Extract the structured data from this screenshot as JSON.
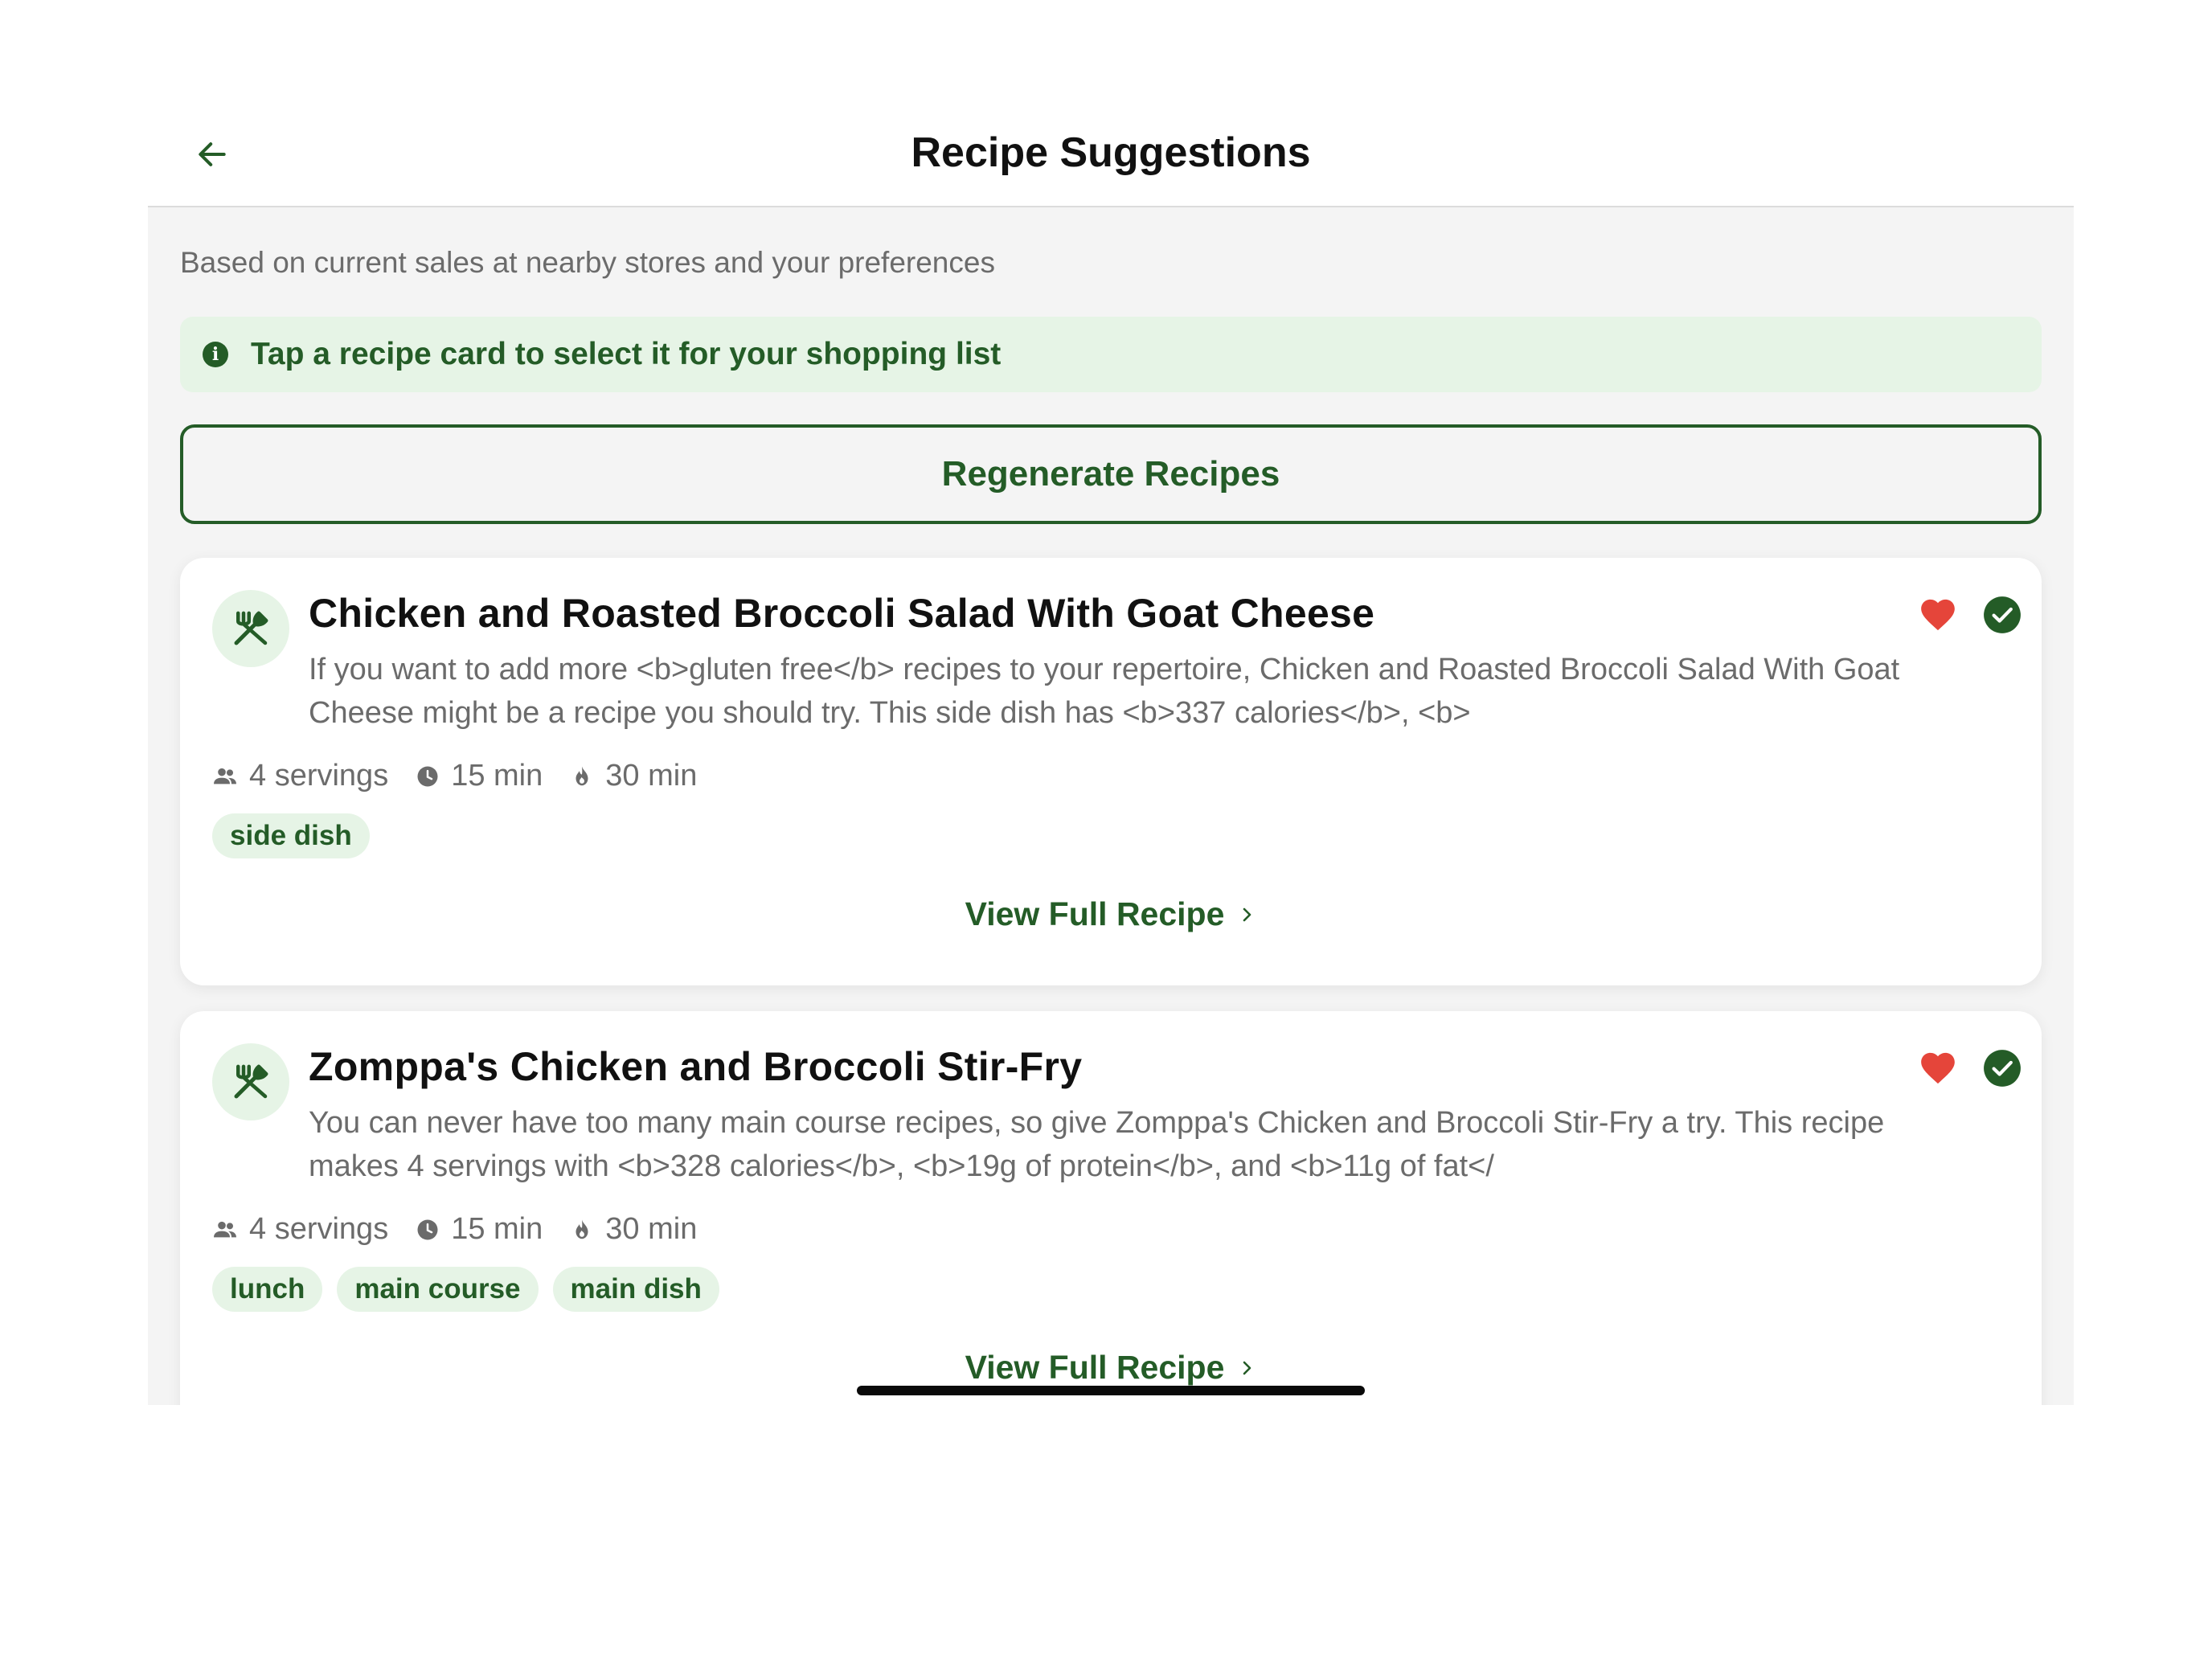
{
  "header": {
    "title": "Recipe Suggestions"
  },
  "subtitle": "Based on current sales at nearby stores and your preferences",
  "info_banner": {
    "text": "Tap a recipe card to select it for your shopping list",
    "icon": "info-icon"
  },
  "regenerate_button": {
    "label": "Regenerate Recipes"
  },
  "recipes": [
    {
      "title": "Chicken and Roasted Broccoli Salad With Goat Cheese",
      "description": "If you want to add more <b>gluten free</b> recipes to your repertoire, Chicken and Roasted Broccoli Salad With Goat Cheese might be a recipe you should try. This side dish has <b>337 calories</b>, <b>",
      "servings": "4 servings",
      "prep_time": "15 min",
      "cook_time": "30 min",
      "tags": [
        "side dish"
      ],
      "favorited": true,
      "selected": true,
      "view_label": "View Full Recipe"
    },
    {
      "title": "Zomppa's Chicken and Broccoli Stir-Fry",
      "description": "You can never have too many main course recipes, so give Zomppa's Chicken and Broccoli Stir-Fry a try. This recipe makes 4 servings with <b>328 calories</b>, <b>19g of protein</b>, and <b>11g of fat</",
      "servings": "4 servings",
      "prep_time": "15 min",
      "cook_time": "30 min",
      "tags": [
        "lunch",
        "main course",
        "main dish"
      ],
      "favorited": true,
      "selected": true,
      "view_label": "View Full Recipe"
    }
  ],
  "colors": {
    "accent": "#245c27",
    "accent_light": "#e6f4e6",
    "heart": "#e5453a",
    "background": "#f4f4f4",
    "text_muted": "#6b6b6b"
  }
}
